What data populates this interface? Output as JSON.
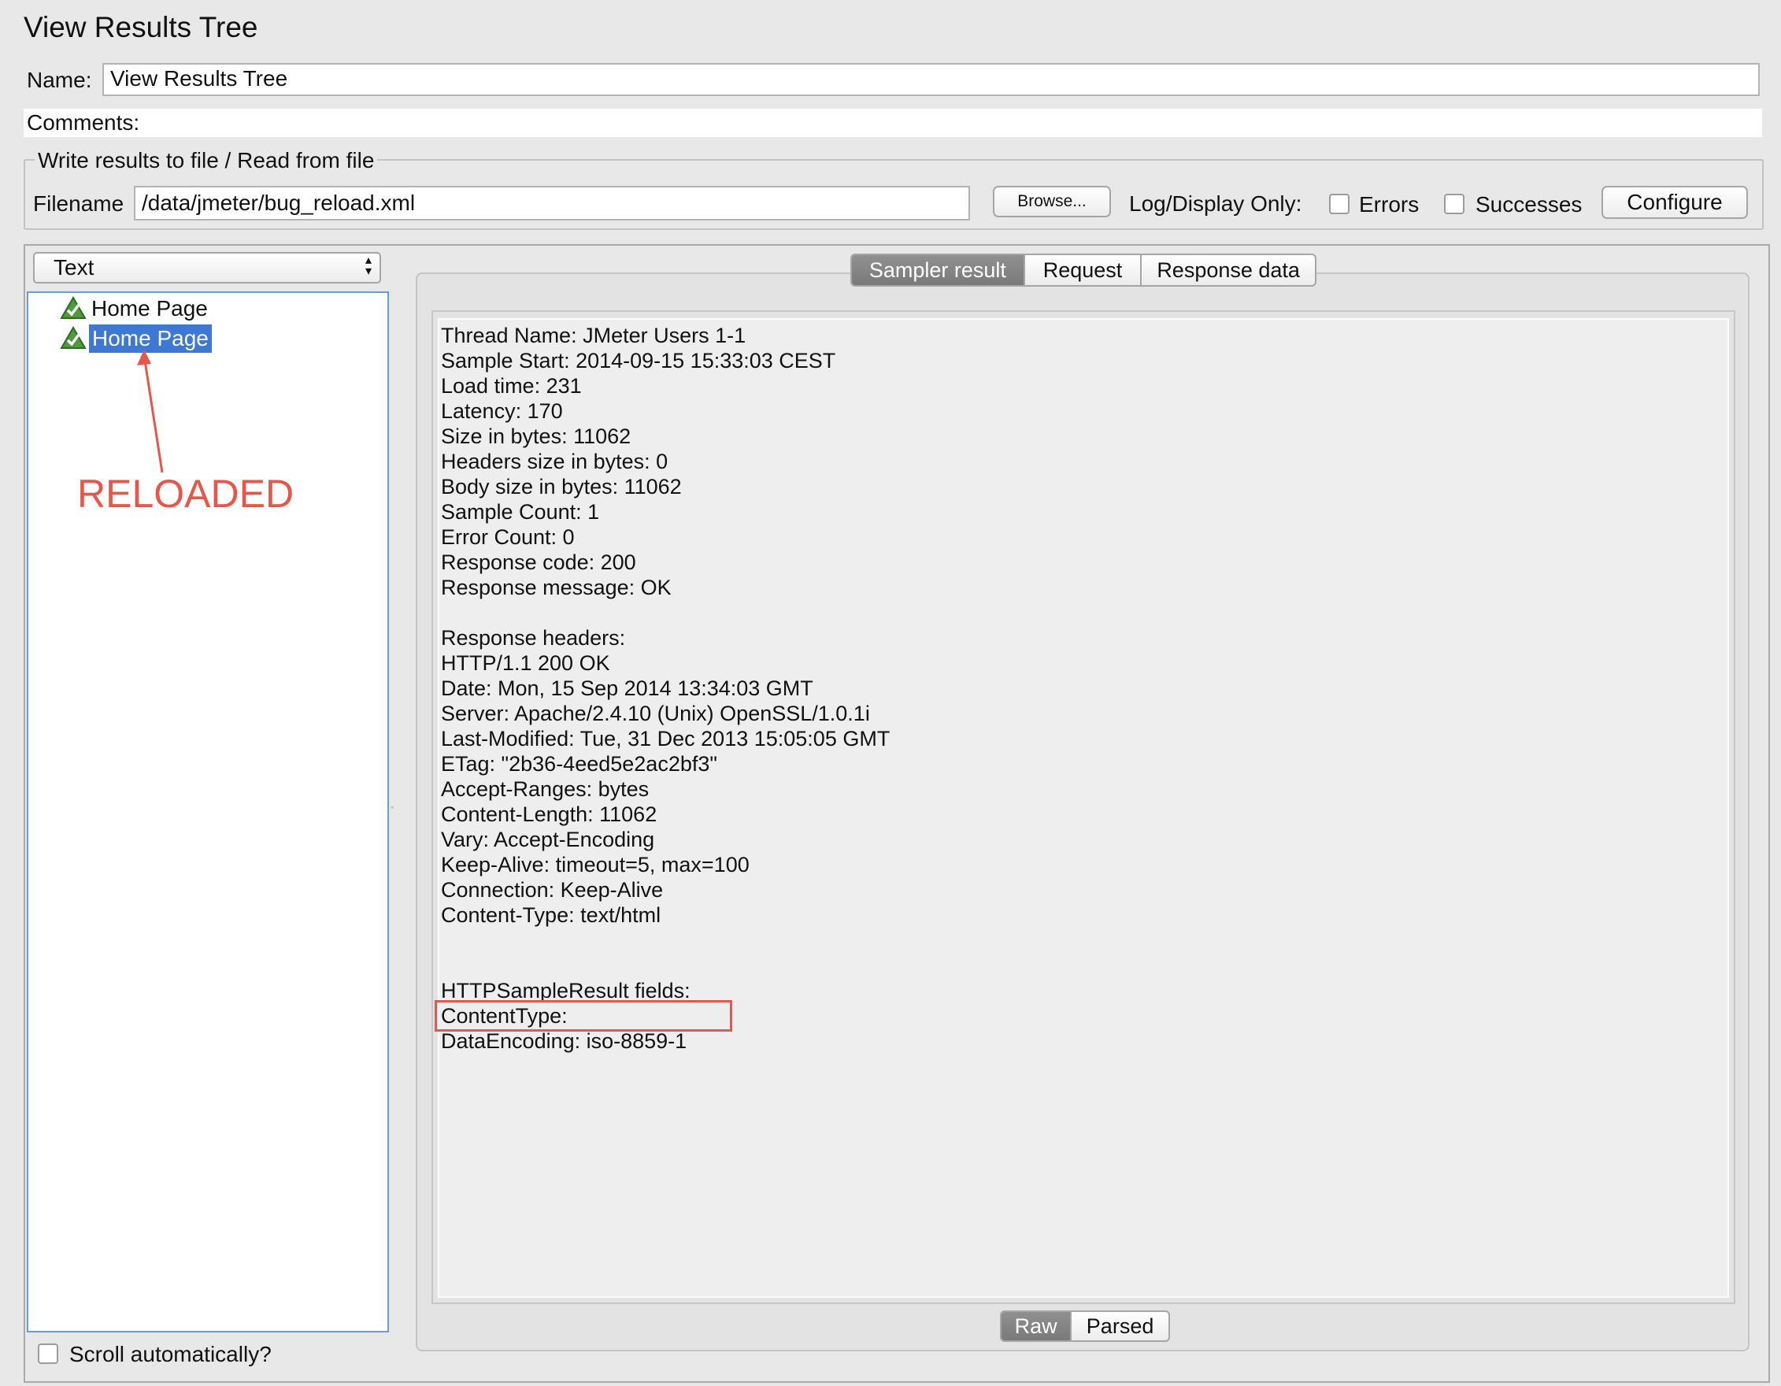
{
  "window": {
    "title": "View Results Tree"
  },
  "name_row": {
    "label": "Name:",
    "value": "View Results Tree"
  },
  "comments_row": {
    "label": "Comments:"
  },
  "file_group": {
    "legend": "Write results to file / Read from file",
    "filename_label": "Filename",
    "filename_value": "/data/jmeter/bug_reload.xml",
    "browse_label": "Browse...",
    "log_display_label": "Log/Display Only:",
    "errors_label": "Errors",
    "successes_label": "Successes",
    "configure_label": "Configure",
    "errors_checked": false,
    "successes_checked": false
  },
  "renderer_select": {
    "value": "Text"
  },
  "tree": {
    "items": [
      {
        "label": "Home Page",
        "icon": "success-shield-icon",
        "selected": false
      },
      {
        "label": "Home Page",
        "icon": "success-shield-icon",
        "selected": true
      }
    ]
  },
  "annotation": {
    "text": "RELOADED",
    "color": "#e8564a"
  },
  "tabs": [
    {
      "label": "Sampler result",
      "selected": true
    },
    {
      "label": "Request",
      "selected": false
    },
    {
      "label": "Response data",
      "selected": false
    }
  ],
  "sampler_result": {
    "lines": [
      "Thread Name: JMeter Users 1-1",
      "Sample Start: 2014-09-15 15:33:03 CEST",
      "Load time: 231",
      "Latency: 170",
      "Size in bytes: 11062",
      "Headers size in bytes: 0",
      "Body size in bytes: 11062",
      "Sample Count: 1",
      "Error Count: 0",
      "Response code: 200",
      "Response message: OK",
      "",
      "Response headers:",
      "HTTP/1.1 200 OK",
      "Date: Mon, 15 Sep 2014 13:34:03 GMT",
      "Server: Apache/2.4.10 (Unix) OpenSSL/1.0.1i",
      "Last-Modified: Tue, 31 Dec 2013 15:05:05 GMT",
      "ETag: \"2b36-4eed5e2ac2bf3\"",
      "Accept-Ranges: bytes",
      "Content-Length: 11062",
      "Vary: Accept-Encoding",
      "Keep-Alive: timeout=5, max=100",
      "Connection: Keep-Alive",
      "Content-Type: text/html",
      "",
      "",
      "HTTPSampleResult fields:",
      "ContentType: ",
      "DataEncoding: iso-8859-1"
    ],
    "highlighted_line": "ContentType: ",
    "highlight_color": "#e05a4e"
  },
  "view_mode": [
    {
      "label": "Raw",
      "selected": true
    },
    {
      "label": "Parsed",
      "selected": false
    }
  ],
  "scroll_auto": {
    "label": "Scroll automatically?",
    "checked": false
  }
}
